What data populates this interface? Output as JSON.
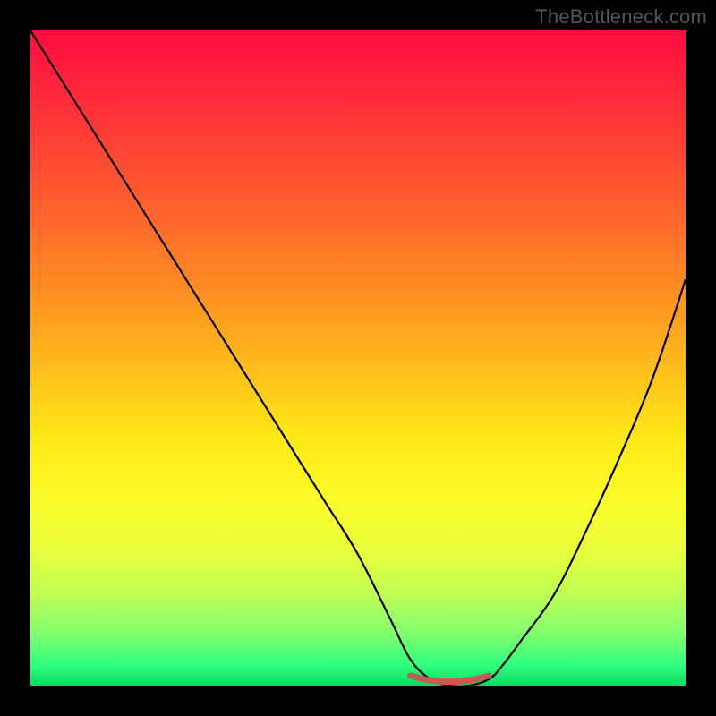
{
  "watermark": "TheBottleneck.com",
  "colors": {
    "frame": "#000000",
    "curve": "#000000",
    "accent": "#c55c54",
    "gradient_stops": [
      "#ff0d3f",
      "#ff2a3a",
      "#ff5a2f",
      "#ff8f22",
      "#ffbf1a",
      "#ffe817",
      "#fcfd2a",
      "#e6ff3d",
      "#bfff55",
      "#82ff6e",
      "#2dff7e",
      "#11d660"
    ]
  },
  "chart_data": {
    "type": "line",
    "title": "",
    "xlabel": "",
    "ylabel": "",
    "xlim": [
      0,
      100
    ],
    "ylim": [
      0,
      100
    ],
    "series": [
      {
        "name": "bottleneck-curve",
        "x": [
          0,
          5,
          10,
          15,
          20,
          25,
          30,
          35,
          40,
          45,
          50,
          55,
          58,
          61,
          64,
          67,
          70,
          72,
          75,
          80,
          85,
          90,
          95,
          100
        ],
        "y": [
          100,
          92,
          84,
          76,
          68,
          60,
          52,
          44,
          36,
          28,
          20,
          10,
          4,
          1,
          0,
          0,
          1,
          3,
          7,
          14,
          24,
          35,
          47,
          62
        ]
      }
    ],
    "accent_segment": {
      "name": "highlighted-flat-region",
      "x": [
        58,
        61,
        64,
        67,
        70
      ],
      "y": [
        1.5,
        0.8,
        0.6,
        0.8,
        1.5
      ]
    },
    "annotations": []
  }
}
